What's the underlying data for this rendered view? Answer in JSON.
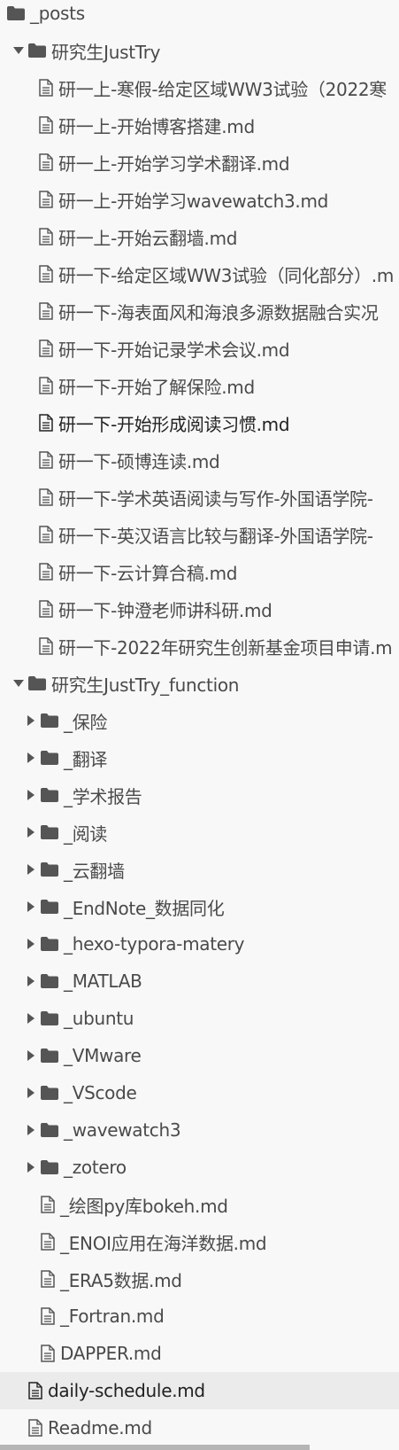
{
  "tree": {
    "root": {
      "label": "_posts",
      "icon": "folder-icon"
    },
    "folder1": {
      "label": "研究生JustTry",
      "icon": "folder-icon",
      "toggle": "chevron-down-icon",
      "files": [
        "研一上-寒假-给定区域WW3试验（2022寒",
        "研一上-开始博客搭建.md",
        "研一上-开始学习学术翻译.md",
        "研一上-开始学习wavewatch3.md",
        "研一上-开始云翻墙.md",
        "研一下-给定区域WW3试验（同化部分）.m",
        "研一下-海表面风和海浪多源数据融合实况",
        "研一下-开始记录学术会议.md",
        "研一下-开始了解保险.md",
        "研一下-开始形成阅读习惯.md",
        "研一下-硕博连读.md",
        "研一下-学术英语阅读与写作-外国语学院-",
        "研一下-英汉语言比较与翻译-外国语学院-",
        "研一下-云计算合稿.md",
        "研一下-钟澄老师讲科研.md",
        "研一下-2022年研究生创新基金项目申请.m"
      ],
      "hovered_index": 9
    },
    "folder2": {
      "label": "研究生JustTry_function",
      "icon": "folder-icon",
      "toggle": "chevron-down-icon",
      "subfolders": [
        "_保险",
        "_翻译",
        "_学术报告",
        "_阅读",
        "_云翻墙",
        "_EndNote_数据同化",
        "_hexo-typora-matery",
        "_MATLAB",
        "_ubuntu",
        "_VMware",
        "_VScode",
        "_wavewatch3",
        "_zotero"
      ],
      "files": [
        "_绘图py库bokeh.md",
        "_ENOI应用在海洋数据.md",
        "_ERA5数据.md",
        "_Fortran.md",
        "DAPPER.md"
      ]
    },
    "root_files": [
      {
        "label": "daily-schedule.md",
        "active": true
      },
      {
        "label": "Readme.md",
        "active": false
      }
    ]
  },
  "colors": {
    "background": "#f8f8f8",
    "active_row": "#ebebeb",
    "text": "#4a4a4a",
    "icon": "#555555",
    "scrollbar": "#b5b5b5"
  }
}
